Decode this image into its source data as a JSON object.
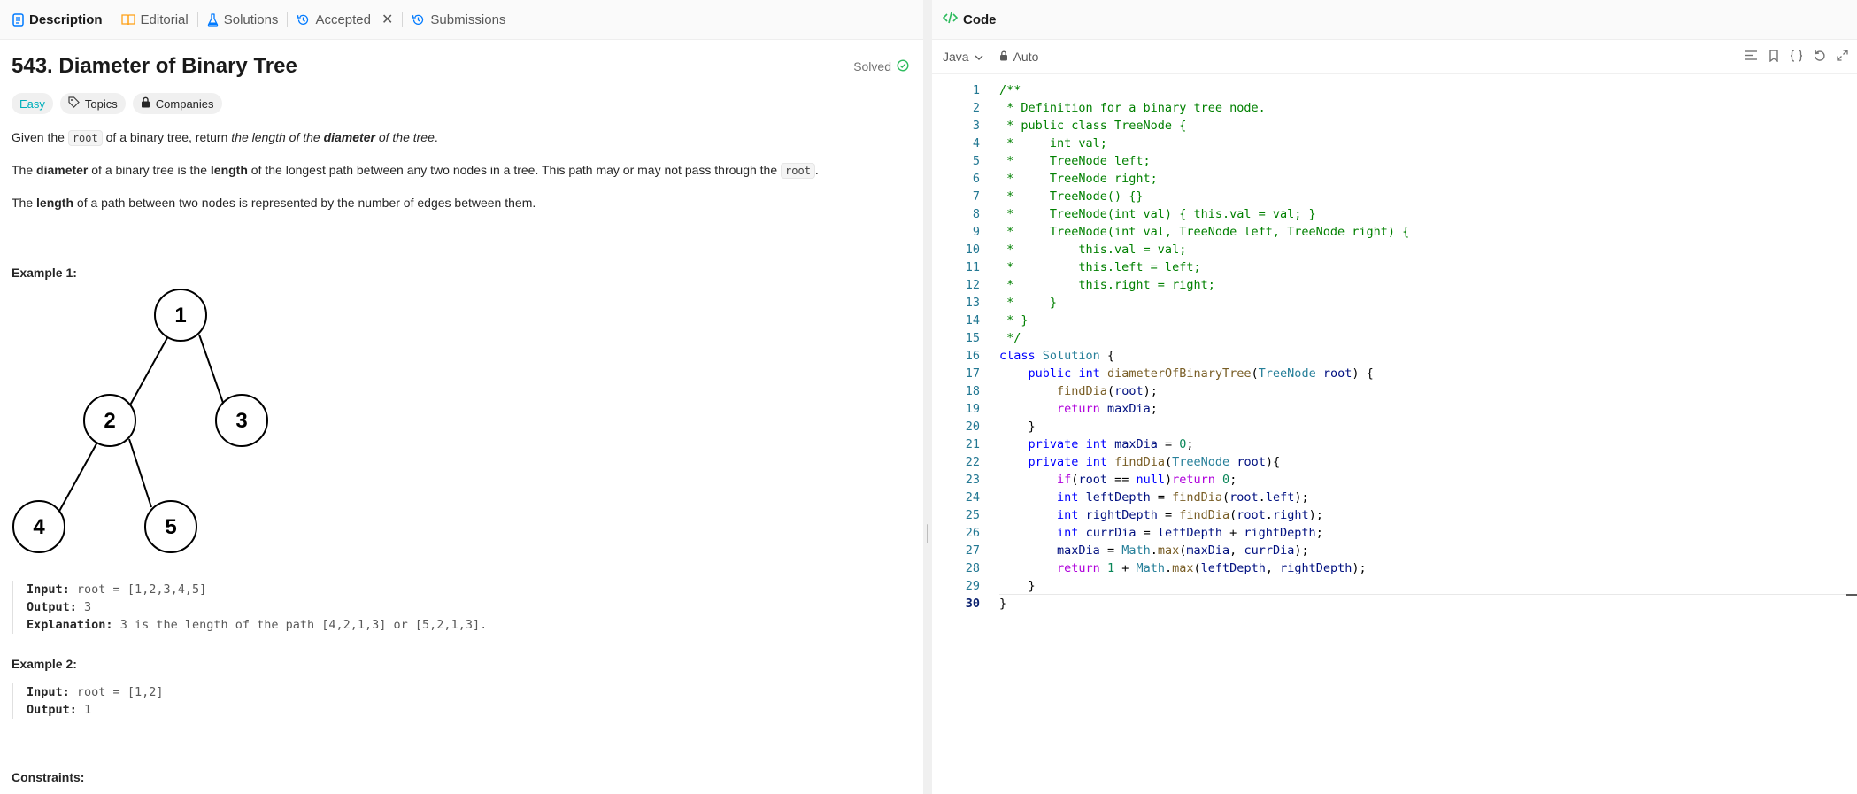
{
  "left_tabs": [
    {
      "label": "Description",
      "icon": "description-icon",
      "active": true
    },
    {
      "label": "Editorial",
      "icon": "book-icon",
      "active": false
    },
    {
      "label": "Solutions",
      "icon": "flask-icon",
      "active": false
    },
    {
      "label": "Accepted",
      "icon": "history-icon",
      "active": false,
      "closable": true
    },
    {
      "label": "Submissions",
      "icon": "history-icon",
      "active": false
    }
  ],
  "problem": {
    "title": "543. Diameter of Binary Tree",
    "status": "Solved",
    "difficulty": "Easy",
    "topics_label": "Topics",
    "companies_label": "Companies",
    "p1_a": "Given the ",
    "p1_code": "root",
    "p1_b": " of a binary tree, return ",
    "p1_c": "the length of the ",
    "p1_d": "diameter",
    "p1_e": " of the tree",
    "p1_f": ".",
    "p2_a": "The ",
    "p2_b": "diameter",
    "p2_c": " of a binary tree is the ",
    "p2_d": "length",
    "p2_e": " of the longest path between any two nodes in a tree. This path may or may not pass through the ",
    "p2_code": "root",
    "p2_f": ".",
    "p3_a": "The ",
    "p3_b": "length",
    "p3_c": " of a path between two nodes is represented by the number of edges between them.",
    "example1_title": "Example 1:",
    "tree_nodes": [
      "1",
      "2",
      "3",
      "4",
      "5"
    ],
    "ex1_input_label": "Input:",
    "ex1_input": "root = [1,2,3,4,5]",
    "ex1_output_label": "Output:",
    "ex1_output": "3",
    "ex1_expl_label": "Explanation:",
    "ex1_expl": "3 is the length of the path [4,2,1,3] or [5,2,1,3].",
    "example2_title": "Example 2:",
    "ex2_input_label": "Input:",
    "ex2_input": "root = [1,2]",
    "ex2_output_label": "Output:",
    "ex2_output": "1",
    "constraints_title": "Constraints:"
  },
  "code_panel": {
    "title": "Code",
    "language": "Java",
    "mode": "Auto",
    "current_line": 30
  },
  "code_lines": [
    "/**",
    " * Definition for a binary tree node.",
    " * public class TreeNode {",
    " *     int val;",
    " *     TreeNode left;",
    " *     TreeNode right;",
    " *     TreeNode() {}",
    " *     TreeNode(int val) { this.val = val; }",
    " *     TreeNode(int val, TreeNode left, TreeNode right) {",
    " *         this.val = val;",
    " *         this.left = left;",
    " *         this.right = right;",
    " *     }",
    " * }",
    " */",
    "class Solution {",
    "    public int diameterOfBinaryTree(TreeNode root) {",
    "        findDia(root);",
    "        return maxDia;",
    "    }",
    "    private int maxDia = 0;",
    "    private int findDia(TreeNode root){",
    "        if(root == null)return 0;",
    "        int leftDepth = findDia(root.left);",
    "        int rightDepth = findDia(root.right);",
    "        int currDia = leftDepth + rightDepth;",
    "        maxDia = Math.max(maxDia, currDia);",
    "        return 1 + Math.max(leftDepth, rightDepth);",
    "    }",
    "}"
  ]
}
